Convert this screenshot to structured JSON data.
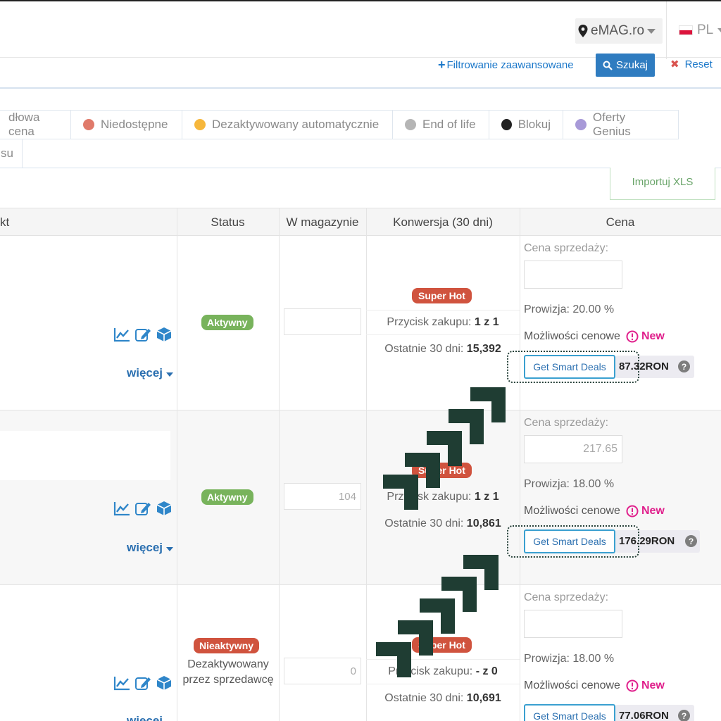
{
  "header": {
    "store": "eMAG.ro",
    "language": "PL"
  },
  "filters": {
    "advanced_label": "Filtrowanie zaawansowane",
    "search_label": "Szukaj",
    "reset_label": "Reset"
  },
  "legend": {
    "items": [
      {
        "label": "dłowa cena",
        "color": ""
      },
      {
        "label": "Niedostępne",
        "color": "#e07a6a"
      },
      {
        "label": "Dezaktywowany automatycznie",
        "color": "#f6b73c"
      },
      {
        "label": "End of life",
        "color": "#b5b5b5"
      },
      {
        "label": "Blokuj",
        "color": "#222222"
      },
      {
        "label": "Oferty Genius",
        "color": "#a89ad8"
      }
    ],
    "second_row_label": "su"
  },
  "import_label": "Importuj XLS",
  "table": {
    "headers": {
      "product": "kt",
      "status": "Status",
      "stock": "W magazynie",
      "conversion": "Konwersja (30 dni)",
      "price": "Cena"
    },
    "more_label": "więcej",
    "rows": [
      {
        "status": "Aktywny",
        "status_note": "",
        "stock": "",
        "hot": "Super Hot",
        "buy_button_label": "Przycisk zakupu:",
        "buy_button_value": "1 z 1",
        "last30_label": "Ostatnie 30 dni:",
        "last30_value": "15,392",
        "price_label": "Cena sprzedaży:",
        "price_value": "",
        "commission": "Prowizja:  20.00 %",
        "opportunities": "Możliwości cenowe",
        "new_label": "New",
        "deal_label": "Get Smart Deals",
        "deal_price": "87.32RON"
      },
      {
        "status": "Aktywny",
        "status_note": "",
        "stock": "104",
        "hot": "Super Hot",
        "buy_button_label": "Przycisk zakupu:",
        "buy_button_value": "1 z 1",
        "last30_label": "Ostatnie 30 dni:",
        "last30_value": "10,861",
        "price_label": "Cena sprzedaży:",
        "price_value": "217.65",
        "commission": "Prowizja:  18.00 %",
        "opportunities": "Możliwości cenowe",
        "new_label": "New",
        "deal_label": "Get Smart Deals",
        "deal_price": "176.29RON"
      },
      {
        "status": "Nieaktywny",
        "status_note": "Dezaktywowany przez sprzedawcę",
        "stock": "0",
        "hot": "Super Hot",
        "buy_button_label": "Przycisk zakupu:",
        "buy_button_value": "- z 0",
        "last30_label": "Ostatnie 30 dni:",
        "last30_value": "10,691",
        "price_label": "Cena sprzedaży:",
        "price_value": "",
        "commission": "Prowizja:  18.00 %",
        "opportunities": "Możliwości cenowe",
        "new_label": "New",
        "deal_label": "Get Smart Deals",
        "deal_price": "77.06RON"
      }
    ]
  },
  "colors": {
    "link_blue": "#1a77c9",
    "search_button": "#2f7cc0",
    "active_green": "#78b35c",
    "inactive_red": "#d0533e",
    "new_pink": "#e0208c",
    "arrow_overlay": "#1f3d33"
  }
}
